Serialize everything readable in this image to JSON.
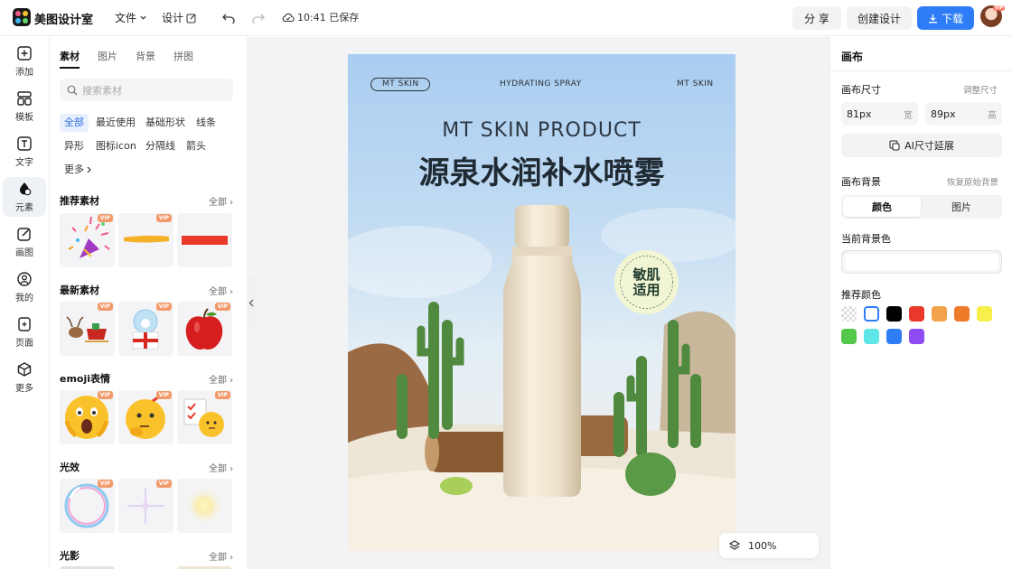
{
  "app": {
    "title": "美图设计室"
  },
  "topbar": {
    "menu_file": "文件",
    "menu_design": "设计",
    "save_status": "10:41 已保存",
    "share": "分 享",
    "create": "创建设计",
    "download": "下载",
    "avatar_badge": "VIP"
  },
  "nav": [
    {
      "label": "添加",
      "icon": "plus-square-icon"
    },
    {
      "label": "模板",
      "icon": "template-icon"
    },
    {
      "label": "文字",
      "icon": "text-icon"
    },
    {
      "label": "元素",
      "icon": "shapes-icon",
      "active": true
    },
    {
      "label": "画图",
      "icon": "draw-icon"
    },
    {
      "label": "我的",
      "icon": "user-icon"
    },
    {
      "label": "页面",
      "icon": "add-page-icon"
    },
    {
      "label": "更多",
      "icon": "cube-icon"
    }
  ],
  "panel": {
    "tabs": [
      "素材",
      "图片",
      "背景",
      "拼图"
    ],
    "active_tab": "素材",
    "search_placeholder": "搜索素材",
    "chips": [
      "全部",
      "最近使用",
      "基础形状",
      "线条",
      "异形",
      "图标icon",
      "分隔线",
      "箭头",
      "更多"
    ],
    "see_all": "全部",
    "vip": "VIP",
    "sections": [
      {
        "title": "推荐素材",
        "items": [
          "party-popper",
          "yellow-brush-stroke",
          "red-bar"
        ]
      },
      {
        "title": "最新素材",
        "items": [
          "reindeer-sleigh",
          "snow-globe-gift",
          "red-apple"
        ]
      },
      {
        "title": "emoji表情",
        "items": [
          "scared-emoji",
          "thinking-emoji",
          "checklist-emoji"
        ]
      },
      {
        "title": "光效",
        "items": [
          "bubble-ring",
          "sparkle-star",
          "soft-glow"
        ]
      },
      {
        "title": "光影",
        "items": []
      }
    ]
  },
  "poster": {
    "brand_left": "MT SKIN",
    "top_center": "HYDRATING SPRAY",
    "brand_right": "MT SKIN",
    "title_en": "MT SKIN PRODUCT",
    "title_cn": "源泉水润补水喷雾",
    "badge": "敏肌适用",
    "badge_ring": "SKIN APPLICATION"
  },
  "zoom": "100%",
  "right": {
    "header": "画布",
    "size_label": "画布尺寸",
    "adjust_size": "调整尺寸",
    "width_value": "81px",
    "width_unit": "宽",
    "height_value": "89px",
    "height_unit": "高",
    "ai_extend": "AI尺寸延展",
    "bg_label": "画布背景",
    "restore_bg": "恢复原始背景",
    "seg_color": "颜色",
    "seg_image": "图片",
    "current_bg": "当前背景色",
    "recommend_colors": "推荐颜色",
    "swatches": [
      "transparent",
      "#ffffff",
      "#000000",
      "#e8392b",
      "#f2a24a",
      "#ee7a2a",
      "#f7f04a",
      "#53c84a",
      "#5fe6e6",
      "#2f7df6",
      "#8f4cf2"
    ]
  }
}
